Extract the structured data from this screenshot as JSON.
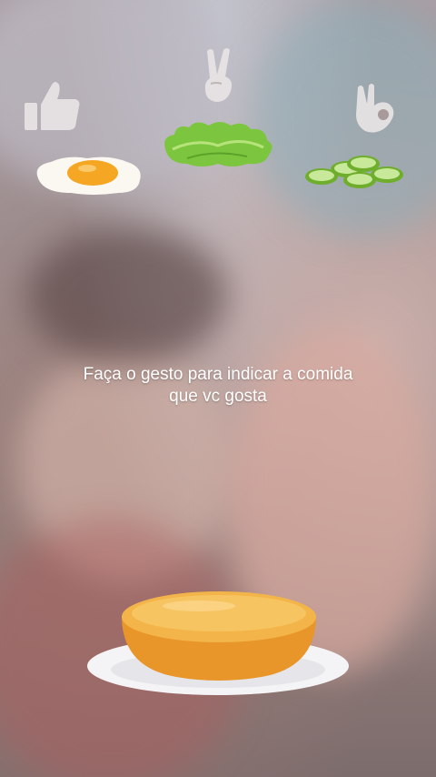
{
  "instruction": {
    "line1": "Faça o gesto para indicar a comida",
    "line2": "que vc gosta"
  },
  "gestures": [
    {
      "name": "thumbs-up-icon",
      "food": "fried-egg-icon"
    },
    {
      "name": "peace-sign-icon",
      "food": "lettuce-icon"
    },
    {
      "name": "ok-hand-icon",
      "food": "cucumber-slices-icon"
    }
  ],
  "colors": {
    "instruction_text": "#ffffff",
    "icon_fill": "#e9e4e4",
    "bun": "#e8962a",
    "plate": "#f4f4f6"
  }
}
